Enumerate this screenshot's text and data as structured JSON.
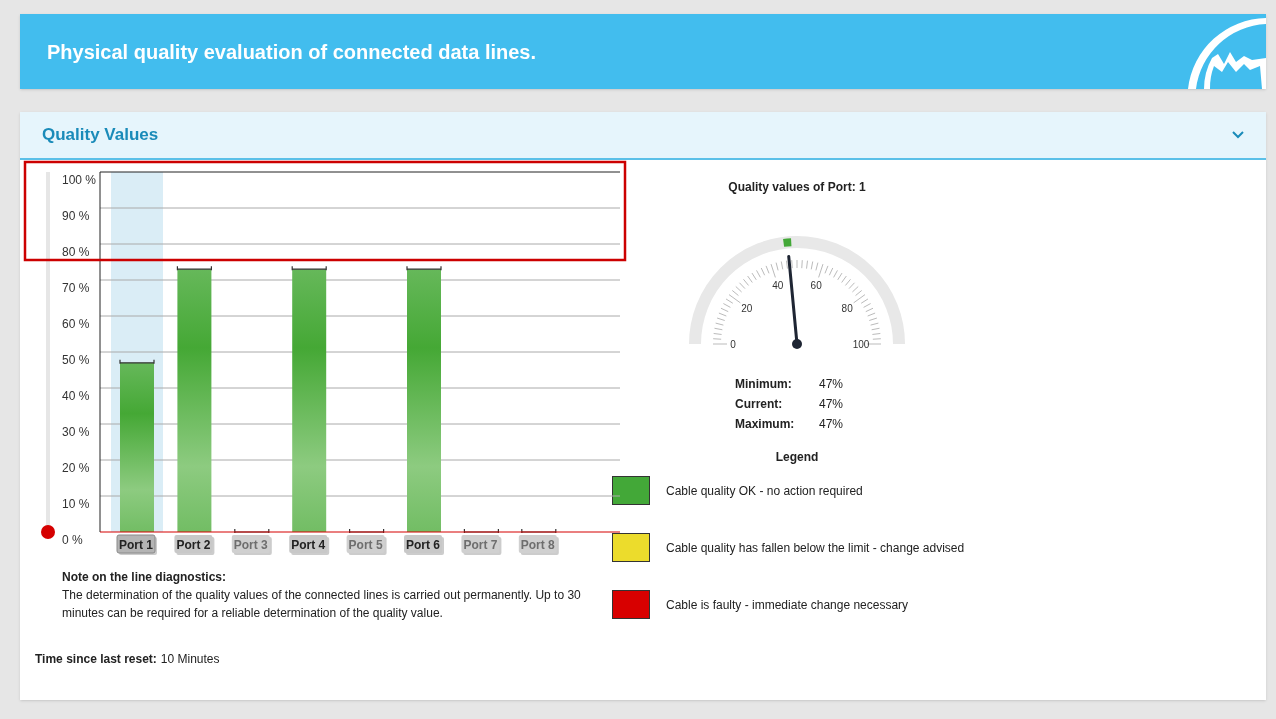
{
  "header": {
    "title": "Physical quality evaluation of connected data lines."
  },
  "panel": {
    "title": "Quality Values",
    "expanded": true
  },
  "highlight_frame": true,
  "threshold_slider": {
    "level": 0
  },
  "chart": {
    "chart_data": {
      "type": "bar",
      "grid": true,
      "categories": [
        "Port 1",
        "Port 2",
        "Port 3",
        "Port 4",
        "Port 5",
        "Port 6",
        "Port 7",
        "Port 8"
      ],
      "values": [
        47,
        73,
        0,
        73,
        0,
        73,
        0,
        0
      ],
      "ylim": [
        0,
        100
      ],
      "yticks": [
        {
          "value": 0,
          "label": "0 %"
        },
        {
          "value": 10,
          "label": "10 %"
        },
        {
          "value": 20,
          "label": "20 %"
        },
        {
          "value": 30,
          "label": "30 %"
        },
        {
          "value": 40,
          "label": "40 %"
        },
        {
          "value": 50,
          "label": "50 %"
        },
        {
          "value": 60,
          "label": "60 %"
        },
        {
          "value": 70,
          "label": "70 %"
        },
        {
          "value": 80,
          "label": "80 %"
        },
        {
          "value": 90,
          "label": "90 %"
        },
        {
          "value": 100,
          "label": "100 %"
        }
      ]
    },
    "ports": [
      {
        "selected": true,
        "disabled": false
      },
      {
        "selected": false,
        "disabled": false
      },
      {
        "selected": false,
        "disabled": true
      },
      {
        "selected": false,
        "disabled": false
      },
      {
        "selected": false,
        "disabled": true
      },
      {
        "selected": false,
        "disabled": false
      },
      {
        "selected": false,
        "disabled": true
      },
      {
        "selected": false,
        "disabled": true
      }
    ]
  },
  "note": {
    "title": "Note on the line diagnostics:",
    "text": "The determination of the quality values of the connected lines is carried out permanently. Up to 30 minutes can be required for a reliable determination of the quality value."
  },
  "reset": {
    "label": "Time since last reset:",
    "value": "10 Minutes"
  },
  "gauge": {
    "title": "Quality values of Port: 1",
    "level": 0.47,
    "scale": [
      "0",
      "20",
      "40",
      "60",
      "80",
      "100"
    ]
  },
  "stats": [
    {
      "label": "Minimum:",
      "value": "47%"
    },
    {
      "label": "Current:",
      "value": "47%"
    },
    {
      "label": "Maximum:",
      "value": "47%"
    }
  ],
  "legend": {
    "title": "Legend",
    "items": [
      {
        "color": "#43a838",
        "text": "Cable quality OK - no action required"
      },
      {
        "color": "#ecdc2c",
        "text": "Cable quality has fallen below the limit - change advised"
      },
      {
        "color": "#d80000",
        "text": "Cable is faulty - immediate change necessary"
      }
    ]
  }
}
